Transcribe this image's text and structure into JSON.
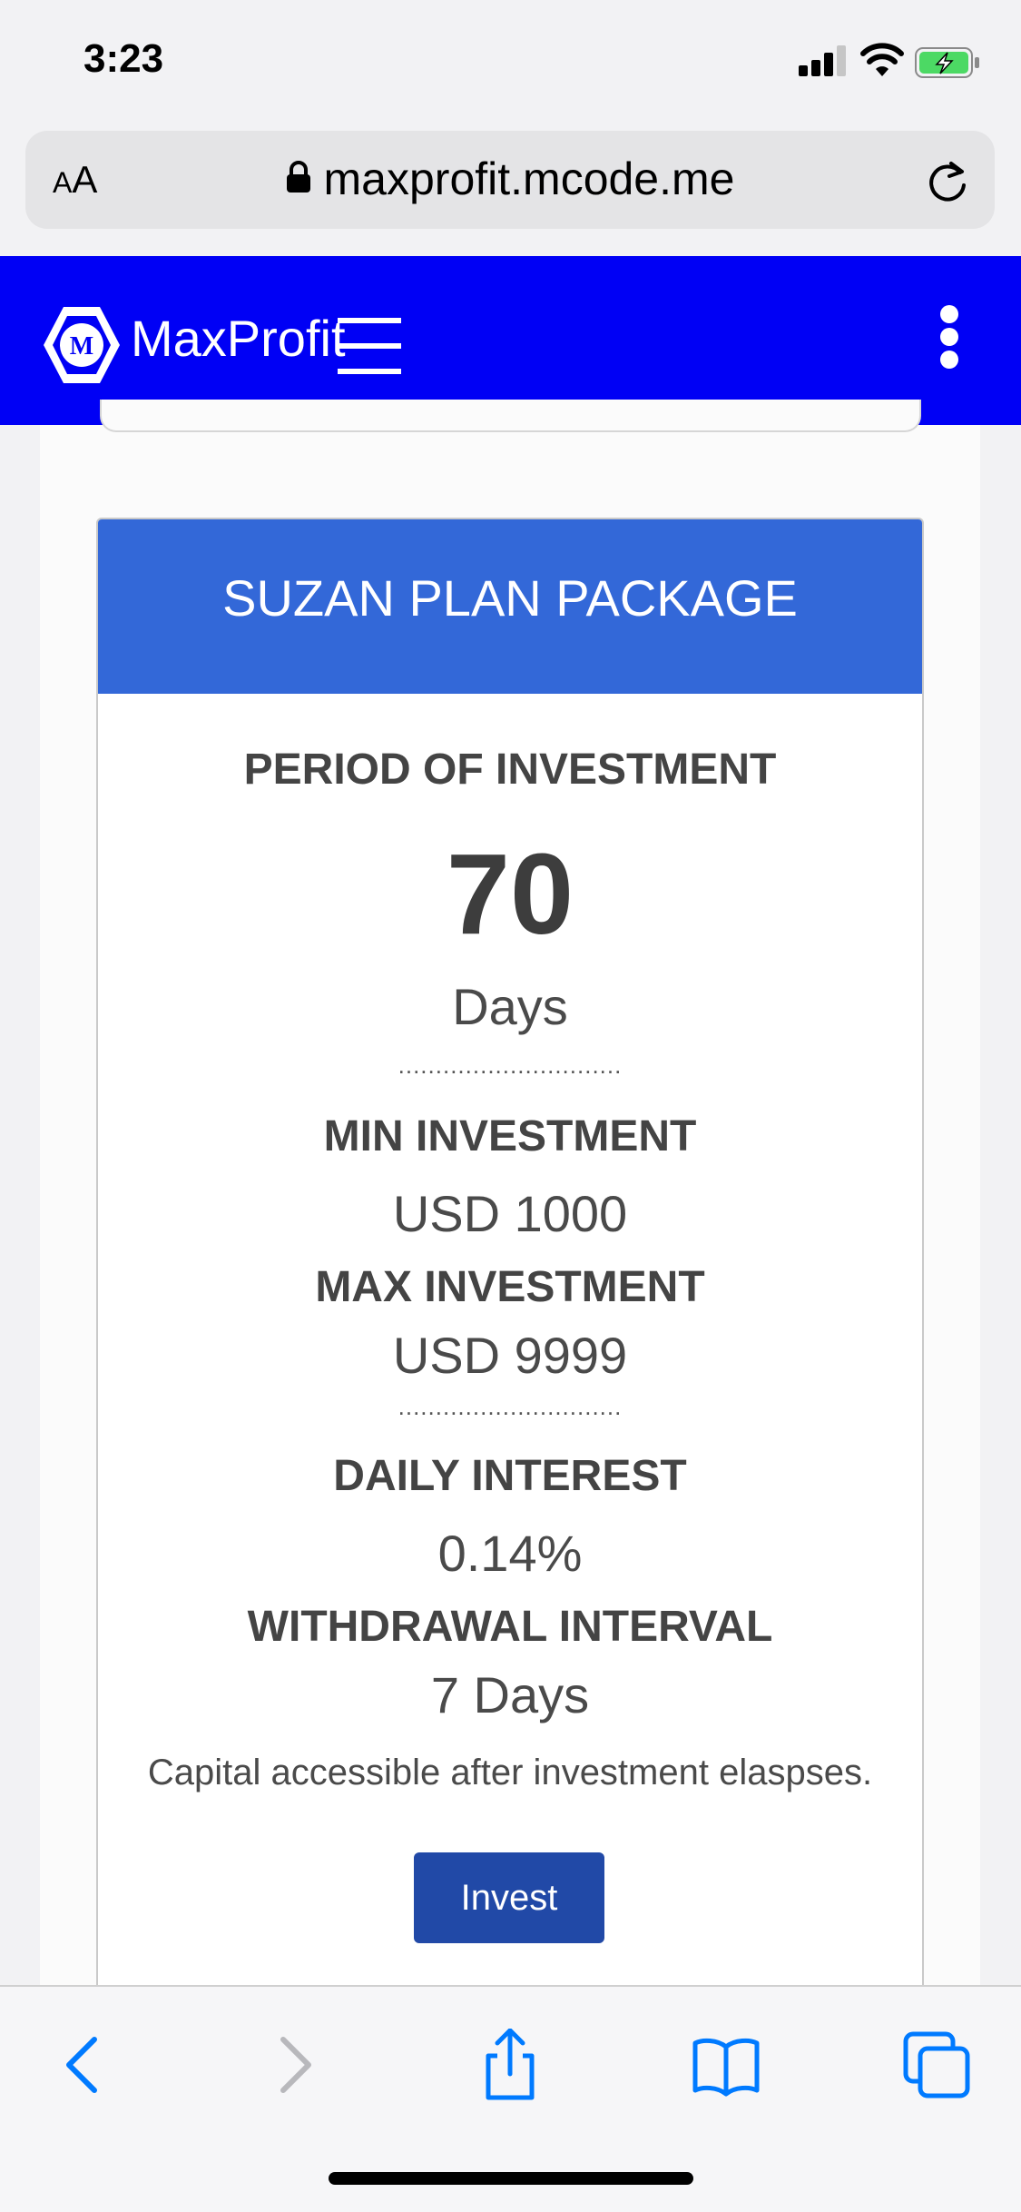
{
  "status_bar": {
    "time": "3:23"
  },
  "browser": {
    "aa_label_small": "A",
    "aa_label_large": "A",
    "url": "maxprofit.mcode.me"
  },
  "site": {
    "brand": "MaxProfit",
    "logo_monogram": "M"
  },
  "plan": {
    "title": "SUZAN PLAN PACKAGE",
    "period_label": "PERIOD OF INVESTMENT",
    "period_value": "70",
    "period_unit": "Days",
    "separator": "..............................",
    "min_label": "MIN INVESTMENT",
    "min_value": "USD 1000",
    "max_label": "MAX INVESTMENT",
    "max_value": "USD 9999",
    "daily_label": "DAILY INTEREST",
    "daily_value": "0.14%",
    "withdrawal_label": "WITHDRAWAL INTERVAL",
    "withdrawal_value": "7 Days",
    "note": "Capital accessible after investment elaspses.",
    "invest_button": "Invest"
  },
  "colors": {
    "header_blue": "#0000f5",
    "plan_header_blue": "#3368d8",
    "invest_button_blue": "#2149a7",
    "ios_tint": "#007aff",
    "battery_green": "#4cd964"
  }
}
